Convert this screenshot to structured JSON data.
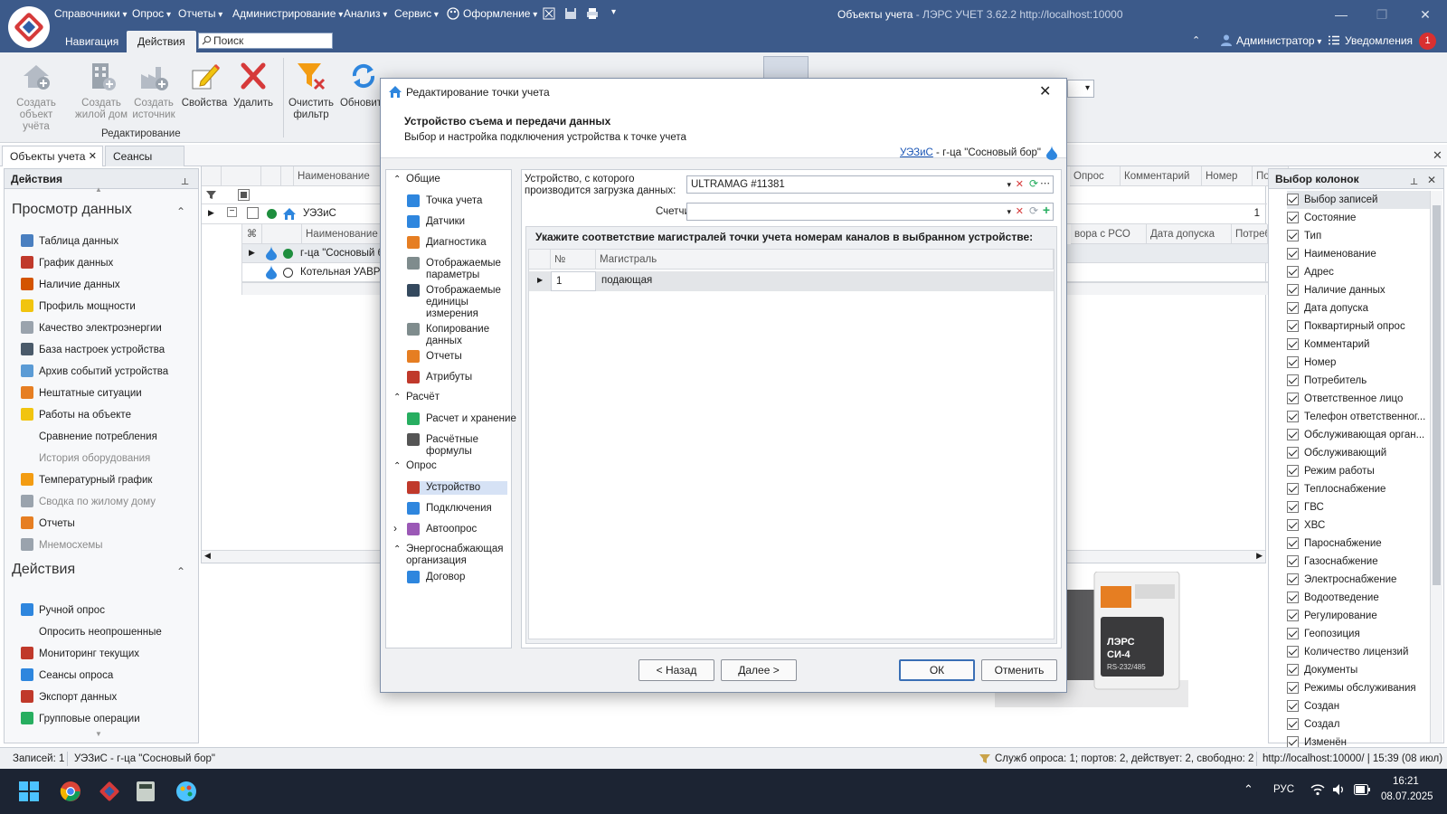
{
  "app": {
    "window_title": "Объекты учета",
    "window_subtitle": " - ЛЭРС УЧЕТ 3.62.2 http://localhost:10000",
    "menu": [
      "Справочники",
      "Опрос",
      "Отчеты",
      "Администрирование",
      "Анализ",
      "Сервис",
      "Оформление"
    ],
    "tabs": [
      "Навигация",
      "Действия"
    ],
    "search_placeholder": "Поиск",
    "user": "Администратор",
    "notifications_label": "Уведомления",
    "notifications_count": "1"
  },
  "ribbon": {
    "buttons": [
      {
        "label": "Создать объект учёта",
        "icon": "house-add-icon"
      },
      {
        "label": "Создать жилой дом",
        "icon": "building-add-icon"
      },
      {
        "label": "Создать источник",
        "icon": "factory-add-icon"
      },
      {
        "label": "Свойства",
        "icon": "edit-pencil-icon"
      },
      {
        "label": "Удалить",
        "icon": "delete-x-icon"
      },
      {
        "label": "Очистить фильтр",
        "icon": "clear-filter-icon"
      },
      {
        "label": "Обновить",
        "icon": "refresh-icon"
      }
    ],
    "group_label": "Редактирование"
  },
  "doc_tabs": [
    "Объекты учета",
    "Сеансы опроса"
  ],
  "left_panel": {
    "title": "Действия",
    "section1": "Просмотр данных",
    "items1": [
      {
        "label": "Таблица данных",
        "icon": "table-icon",
        "color": "#4a7fc0",
        "dim": false
      },
      {
        "label": "График данных",
        "icon": "chart-icon",
        "color": "#c0392b",
        "dim": false
      },
      {
        "label": "Наличие данных",
        "icon": "bars-icon",
        "color": "#d35400",
        "dim": false
      },
      {
        "label": "Профиль мощности",
        "icon": "lightning-icon",
        "color": "#f1c40f",
        "dim": false
      },
      {
        "label": "Качество электроэнергии",
        "icon": "gear-icon",
        "color": "#9aa3ad",
        "dim": false
      },
      {
        "label": "База настроек устройства",
        "icon": "device-icon",
        "color": "#4a5a6a",
        "dim": false
      },
      {
        "label": "Архив событий устройства",
        "icon": "clock-icon",
        "color": "#5b9bd5",
        "dim": false
      },
      {
        "label": "Нештатные ситуации",
        "icon": "warning-icon",
        "color": "#e67e22",
        "dim": false
      },
      {
        "label": "Работы на объекте",
        "icon": "helmet-icon",
        "color": "#f1c40f",
        "dim": false
      },
      {
        "label": "Сравнение потребления",
        "icon": "",
        "color": "",
        "dim": false
      },
      {
        "label": "История оборудования",
        "icon": "",
        "color": "",
        "dim": true
      },
      {
        "label": "Температурный график",
        "icon": "temp-chart-icon",
        "color": "#f39c12",
        "dim": false
      },
      {
        "label": "Сводка по жилому дому",
        "icon": "house-summary-icon",
        "color": "#9aa3ad",
        "dim": true
      },
      {
        "label": "Отчеты",
        "icon": "report-icon",
        "color": "#e67e22",
        "dim": false
      },
      {
        "label": "Мнемосхемы",
        "icon": "scheme-icon",
        "color": "#9aa3ad",
        "dim": true
      }
    ],
    "section2": "Действия",
    "items2": [
      {
        "label": "Ручной опрос",
        "icon": "play-icon",
        "color": "#2e86de",
        "dim": false
      },
      {
        "label": "Опросить неопрошенные",
        "icon": "",
        "color": "",
        "dim": false
      },
      {
        "label": "Мониторинг текущих",
        "icon": "monitor-icon",
        "color": "#c0392b",
        "dim": false
      },
      {
        "label": "Сеансы опроса",
        "icon": "sessions-icon",
        "color": "#2e86de",
        "dim": false
      },
      {
        "label": "Экспорт данных",
        "icon": "export-icon",
        "color": "#c0392b",
        "dim": false
      },
      {
        "label": "Групповые операции",
        "icon": "check-icon",
        "color": "#27ae60",
        "dim": false
      }
    ]
  },
  "grid": {
    "headers": [
      "Наименование",
      "Опрос",
      "Комментарий",
      "Номер",
      "Потреб"
    ],
    "parent_row": {
      "name": "УЭЗиС",
      "number": "1"
    },
    "child_headers": [
      "Наименование",
      "вора с РСО",
      "Дата допуска",
      "Потребл"
    ],
    "child_rows": [
      {
        "name": "г-ца \"Сосновый б"
      },
      {
        "name": "Котельная УАВР"
      }
    ]
  },
  "right_panel": {
    "title": "Выбор колонок",
    "columns": [
      "Выбор записей",
      "Состояние",
      "Тип",
      "Наименование",
      "Адрес",
      "Наличие данных",
      "Дата допуска",
      "Поквартирный опрос",
      "Комментарий",
      "Номер",
      "Потребитель",
      "Ответственное лицо",
      "Телефон ответственног...",
      "Обслуживающая орган...",
      "Обслуживающий",
      "Режим работы",
      "Теплоснабжение",
      "ГВС",
      "ХВС",
      "Пароснабжение",
      "Газоснабжение",
      "Электроснабжение",
      "Водоотведение",
      "Регулирование",
      "Геопозиция",
      "Количество лицензий",
      "Документы",
      "Режимы обслуживания",
      "Создан",
      "Создал",
      "Изменён"
    ]
  },
  "dialog": {
    "title": "Редактирование точки учета",
    "header_title": "Устройство съема и передачи данных",
    "header_subtitle": "Выбор и настройка подключения устройства к точке учета",
    "breadcrumb_link": "УЭЗиС",
    "breadcrumb_rest": " - г-ца \"Сосновый бор\"",
    "nav": [
      {
        "type": "group",
        "label": "Общие"
      },
      {
        "type": "item",
        "label": "Точка учета",
        "icon": "point-icon",
        "color": "#2e86de",
        "lines": 1
      },
      {
        "type": "item",
        "label": "Датчики",
        "icon": "sensor-icon",
        "color": "#2e86de",
        "lines": 1
      },
      {
        "type": "item",
        "label": "Диагностика",
        "icon": "warning-icon",
        "color": "#e67e22",
        "lines": 1
      },
      {
        "type": "item",
        "label": "Отображаемые параметры",
        "icon": "params-icon",
        "color": "#7f8c8d",
        "lines": 2
      },
      {
        "type": "item",
        "label": "Отображаемые единицы измерения",
        "icon": "units-icon",
        "color": "#34495e",
        "lines": 3
      },
      {
        "type": "item",
        "label": "Копирование данных",
        "icon": "copy-icon",
        "color": "#7f8c8d",
        "lines": 2
      },
      {
        "type": "item",
        "label": "Отчеты",
        "icon": "report-icon",
        "color": "#e67e22",
        "lines": 1
      },
      {
        "type": "item",
        "label": "Атрибуты",
        "icon": "attribute-icon",
        "color": "#c0392b",
        "lines": 1
      },
      {
        "type": "group",
        "label": "Расчёт"
      },
      {
        "type": "item",
        "label": "Расчет и хранение",
        "icon": "calc-icon",
        "color": "#27ae60",
        "lines": 1
      },
      {
        "type": "item",
        "label": "Расчётные формулы",
        "icon": "formula-icon",
        "color": "#555555",
        "lines": 2
      },
      {
        "type": "group",
        "label": "Опрос"
      },
      {
        "type": "item",
        "label": "Устройство",
        "icon": "device-icon",
        "color": "#c0392b",
        "lines": 1,
        "selected": true
      },
      {
        "type": "item",
        "label": "Подключения",
        "icon": "globe-icon",
        "color": "#2e86de",
        "lines": 1
      },
      {
        "type": "item",
        "label": "Автоопрос",
        "icon": "alarm-icon",
        "color": "#9b59b6",
        "lines": 1,
        "collapsed": true
      },
      {
        "type": "group",
        "label": "Энергоснабжающая организация",
        "lines": 2
      },
      {
        "type": "item",
        "label": "Договор",
        "icon": "contract-icon",
        "color": "#2e86de",
        "lines": 1
      }
    ],
    "device_label": "Устройство, с которого производится загрузка данных:",
    "device_value": "ULTRAMAG #11381",
    "counter_label": "Счетчик:",
    "counter_value": "",
    "mapping_title": "Укажите соответствие магистралей точки учета номерам каналов в выбранном устройстве:",
    "table_headers": [
      "№",
      "Магистраль"
    ],
    "table_rows": [
      {
        "num": "1",
        "name": "подающая"
      }
    ],
    "buttons": {
      "back": "< Назад",
      "next": "Далее >",
      "ok": "ОК",
      "cancel": "Отменить"
    }
  },
  "product": {
    "brand": "ЛЭРС",
    "model": "СИ-4",
    "interface": "RS-232/485"
  },
  "status": {
    "records": "Записей: 1",
    "current": "УЭЗиС - г-ца \"Сосновый бор\"",
    "services": "Служб опроса: 1; портов: 2, действует: 2, свободно: 2",
    "server": "http://localhost:10000/ | 15:39 (08 июл)"
  },
  "taskbar": {
    "lang": "РУС",
    "time": "16:21",
    "date": "08.07.2025"
  }
}
